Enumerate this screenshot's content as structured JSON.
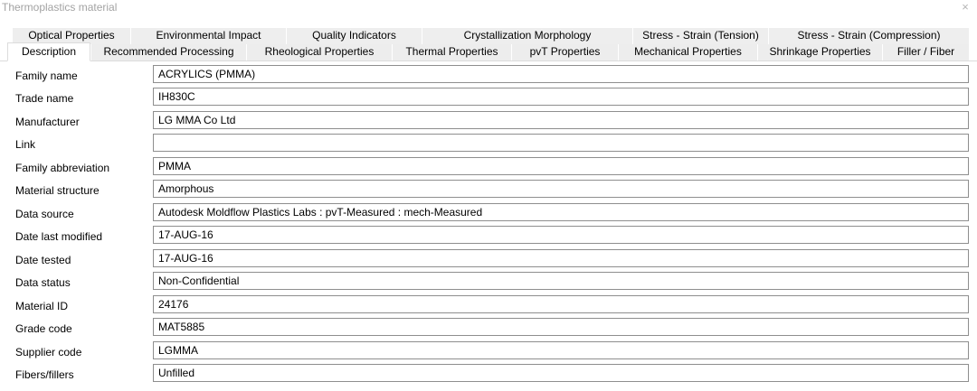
{
  "window": {
    "title": "Thermoplastics material",
    "close_glyph": "×"
  },
  "tabs_back": [
    {
      "label": "Optical Properties"
    },
    {
      "label": "Environmental Impact"
    },
    {
      "label": "Quality Indicators"
    },
    {
      "label": "Crystallization Morphology"
    },
    {
      "label": "Stress - Strain (Tension)"
    },
    {
      "label": "Stress - Strain (Compression)"
    }
  ],
  "tabs_front": [
    {
      "label": "Description",
      "active": true
    },
    {
      "label": "Recommended Processing"
    },
    {
      "label": "Rheological Properties"
    },
    {
      "label": "Thermal Properties"
    },
    {
      "label": "pvT Properties"
    },
    {
      "label": "Mechanical Properties"
    },
    {
      "label": "Shrinkage Properties"
    },
    {
      "label": "Filler / Fiber"
    }
  ],
  "fields": [
    {
      "label": "Family name",
      "value": "ACRYLICS (PMMA)"
    },
    {
      "label": "Trade name",
      "value": "IH830C"
    },
    {
      "label": "Manufacturer",
      "value": "LG MMA Co Ltd"
    },
    {
      "label": "Link",
      "value": ""
    },
    {
      "label": "Family abbreviation",
      "value": "PMMA"
    },
    {
      "label": "Material structure",
      "value": "Amorphous"
    },
    {
      "label": "Data source",
      "value": "Autodesk Moldflow Plastics Labs : pvT-Measured : mech-Measured"
    },
    {
      "label": "Date last modified",
      "value": "17-AUG-16"
    },
    {
      "label": "Date tested",
      "value": "17-AUG-16"
    },
    {
      "label": "Data status",
      "value": "Non-Confidential"
    },
    {
      "label": "Material ID",
      "value": "24176"
    },
    {
      "label": "Grade code",
      "value": "MAT5885"
    },
    {
      "label": "Supplier code",
      "value": "LGMMA"
    },
    {
      "label": "Fibers/fillers",
      "value": "Unfilled"
    }
  ]
}
